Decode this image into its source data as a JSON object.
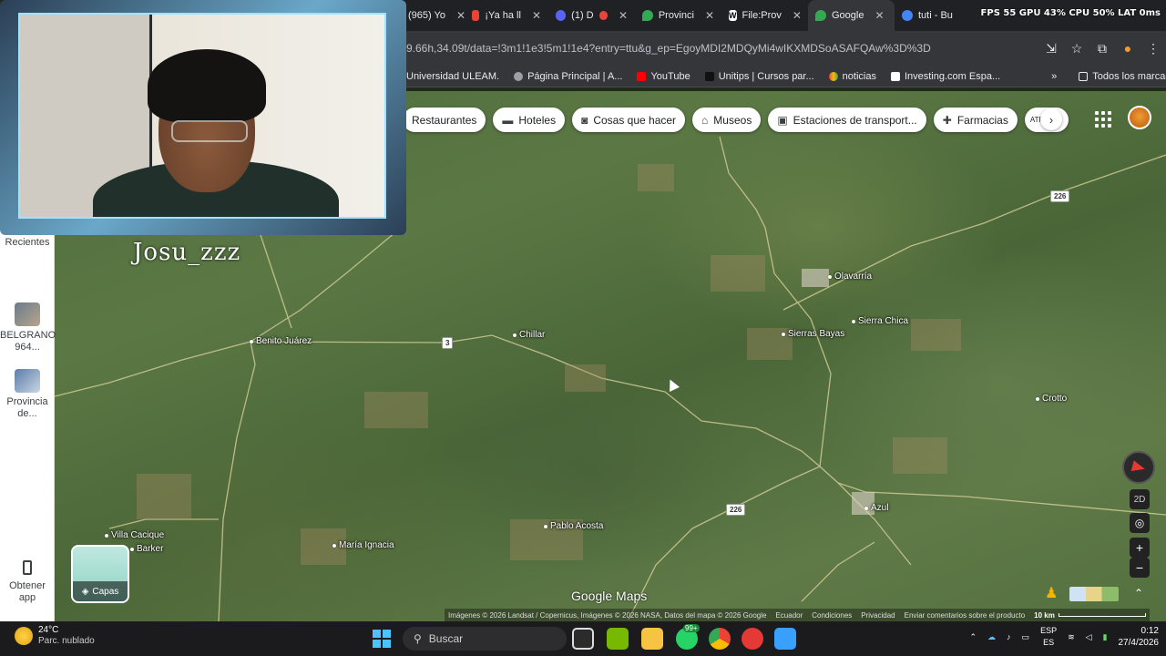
{
  "browser": {
    "tabs": [
      {
        "label": "(965) Yo",
        "color": "#ff0000"
      },
      {
        "label": "¡Ya ha ll",
        "color": "#ea4335",
        "icon": "gmail-icon"
      },
      {
        "label": "(1) D",
        "color": "#5865f2"
      },
      {
        "label": "Provinci",
        "color": "#34a853",
        "icon": "maps-pin-icon"
      },
      {
        "label": "File:Prov",
        "color": "#ffffff",
        "icon": "wikipedia-icon"
      },
      {
        "label": "Google",
        "color": "#34a853",
        "icon": "maps-pin-icon",
        "active": true
      },
      {
        "label": "tuti - Bu",
        "color": "#4285f4",
        "icon": "google-icon"
      }
    ],
    "perf_overlay": "FPS 55  GPU 43%  CPU 50%  LAT 0ms",
    "url": "9.66h,34.09t/data=!3m1!1e3!5m1!1e4?entry=ttu&g_ep=EgoyMDI2MDQyMi4wIKXMDSoASAFQAw%3D%3D",
    "bookmarks": [
      {
        "label": "Universidad ULEAM.",
        "color": "#1a73e8"
      },
      {
        "label": "Página Principal | A...",
        "color": "#9aa0a6"
      },
      {
        "label": "YouTube",
        "color": "#ff0000"
      },
      {
        "label": "Unitips | Cursos par...",
        "color": "#111111"
      },
      {
        "label": "noticias",
        "color": "#f4b400"
      },
      {
        "label": "Investing.com Espa...",
        "color": "#ffffff"
      }
    ],
    "all_bookmarks": "Todos los marcadores"
  },
  "webcam": {
    "name": "Josu_zzz"
  },
  "maps": {
    "chips": [
      {
        "label": "Restaurantes",
        "icon": ""
      },
      {
        "label": "Hoteles",
        "icon": "bed-icon"
      },
      {
        "label": "Cosas que hacer",
        "icon": "camera-icon"
      },
      {
        "label": "Museos",
        "icon": "museum-icon"
      },
      {
        "label": "Estaciones de transport...",
        "icon": "transit-icon"
      },
      {
        "label": "Farmacias",
        "icon": "pharmacy-icon"
      },
      {
        "label": "ATR (",
        "icon": ""
      }
    ],
    "side": {
      "recent": "Recientes",
      "item1": "BELGRANO 964...",
      "item2": "Provincia de...",
      "get_app": "Obtener app"
    },
    "places": [
      {
        "name": "Olavarría"
      },
      {
        "name": "Sierra Chica"
      },
      {
        "name": "Sierras Bayas"
      },
      {
        "name": "Benito Juárez"
      },
      {
        "name": "Chillar"
      },
      {
        "name": "Crotto"
      },
      {
        "name": "Azul"
      },
      {
        "name": "Pablo Acosta"
      },
      {
        "name": "María Ignacia"
      },
      {
        "name": "Villa Cacique"
      },
      {
        "name": "Barker"
      }
    ],
    "route_shields": [
      "226",
      "3",
      "226"
    ],
    "layers_label": "Capas",
    "mode_2d": "2D",
    "logo": "Google Maps",
    "attribution": {
      "imagery": "Imágenes © 2026 Landsat / Copernicus, Imágenes © 2026 NASA, Datos del mapa © 2026 Google",
      "country": "Ecuador",
      "terms": "Condiciones",
      "privacy": "Privacidad",
      "feedback": "Enviar comentarios sobre el producto",
      "scale": "10 km"
    }
  },
  "taskbar": {
    "temp": "24°C",
    "weather": "Parc. nublado",
    "search_placeholder": "Buscar",
    "whatsapp_badge": "99+",
    "lang1": "ESP",
    "lang2": "ES",
    "time": "0:12",
    "date": "27/4/2026"
  }
}
